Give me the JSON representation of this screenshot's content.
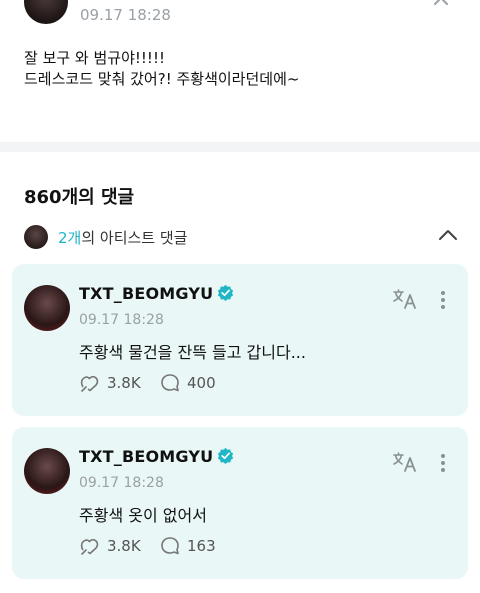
{
  "post": {
    "date": "09.17 18:28",
    "line1": "잘 보구 와 범규야!!!!!",
    "line2": "드레스코드 맞춰 갔어?! 주황색이라던데에~"
  },
  "comments_section": {
    "title": "860개의 댓글",
    "artist_count": "2개",
    "artist_suffix": "의 아티스트 댓글"
  },
  "comments": [
    {
      "name": "TXT_BEOMGYU",
      "date": "09.17 18:28",
      "text": "주황색 물건을 잔뜩 들고 갑니다...",
      "likes": "3.8K",
      "replies": "400"
    },
    {
      "name": "TXT_BEOMGYU",
      "date": "09.17 18:28",
      "text": "주황색 옷이 없어서",
      "likes": "3.8K",
      "replies": "163"
    }
  ],
  "colors": {
    "accent": "#21b6c6",
    "card_bg": "#eaf7f7",
    "muted": "#9aa0a6"
  },
  "icons": [
    "verified-icon",
    "translate-icon",
    "more-icon",
    "like-icon",
    "reply-icon",
    "chevron-up-icon"
  ]
}
